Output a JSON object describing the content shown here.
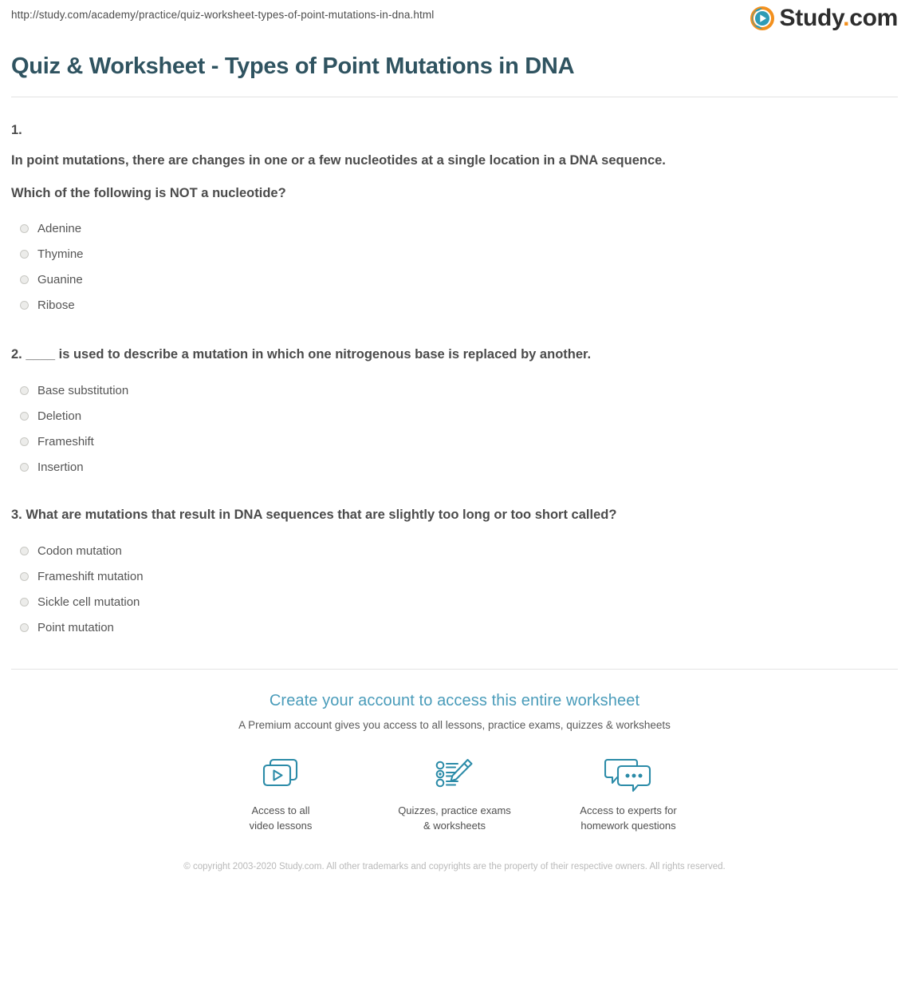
{
  "browser": {
    "url": "http://study.com/academy/practice/quiz-worksheet-types-of-point-mutations-in-dna.html"
  },
  "brand": {
    "name_part1": "Study",
    "name_dot": ".",
    "name_part2": "com",
    "accent_orange": "#f3901d",
    "accent_teal": "#2f9bb5",
    "text_dark": "#2d2d2d"
  },
  "header": {
    "title": "Quiz & Worksheet - Types of Point Mutations in DNA",
    "title_color": "#2f5360"
  },
  "questions": [
    {
      "number": "1.",
      "stem": "In point mutations, there are changes in one or a few nucleotides at a single location in a DNA sequence.",
      "prompt": "Which of the following is NOT a nucleotide?",
      "options": [
        "Adenine",
        "Thymine",
        "Guanine",
        "Ribose"
      ]
    },
    {
      "number": "2.",
      "prompt": "2. ____ is used to describe a mutation in which one nitrogenous base is replaced by another.",
      "options": [
        "Base substitution",
        "Deletion",
        "Frameshift",
        "Insertion"
      ]
    },
    {
      "number": "3.",
      "prompt": "3. What are mutations that result in DNA sequences that are slightly too long or too short called?",
      "options": [
        "Codon mutation",
        "Frameshift mutation",
        "Sickle cell mutation",
        "Point mutation"
      ]
    }
  ],
  "cta": {
    "heading": "Create your account to access this entire worksheet",
    "subheading": "A Premium account gives you access to all lessons, practice exams, quizzes & worksheets",
    "heading_color": "#4a9cba",
    "perks": [
      {
        "icon": "video-lessons-icon",
        "label": "Access to all\nvideo lessons"
      },
      {
        "icon": "quiz-checklist-pencil-icon",
        "label": "Quizzes, practice exams\n& worksheets"
      },
      {
        "icon": "chat-bubbles-icon",
        "label": "Access to experts for\nhomework questions"
      }
    ]
  },
  "footer": {
    "copyright": "© copyright 2003-2020 Study.com. All other trademarks and copyrights are the property of their respective owners. All rights reserved."
  }
}
